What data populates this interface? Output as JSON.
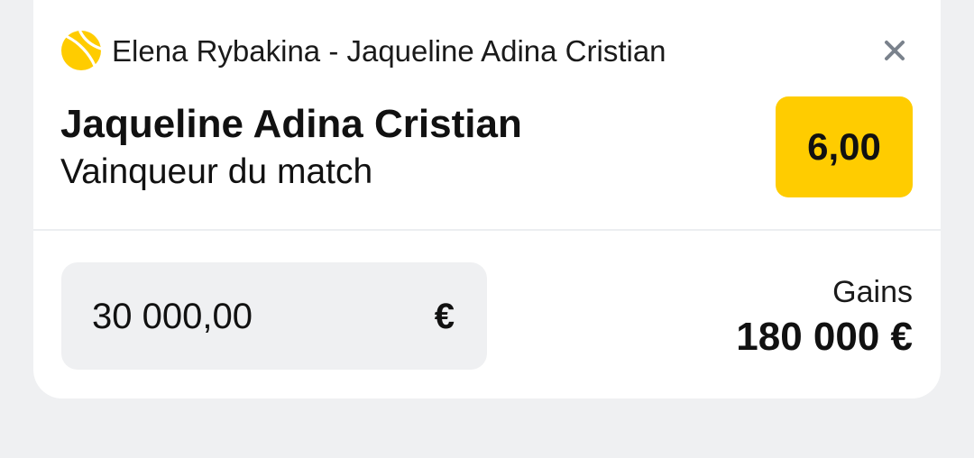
{
  "colors": {
    "accent": "#ffcc00",
    "background": "#eff0f2",
    "card": "#ffffff",
    "close_icon": "#7a828c"
  },
  "bet_slip": {
    "sport_icon": "tennis-ball-icon",
    "event_title": "Elena Rybakina - Jaqueline Adina Cristian",
    "close_icon": "close-icon",
    "selection": "Jaqueline Adina Cristian",
    "market": "Vainqueur du match",
    "odds": "6,00",
    "stake": {
      "value": "30 000,00",
      "currency": "€"
    },
    "gains": {
      "label": "Gains",
      "value": "180 000 €"
    }
  }
}
